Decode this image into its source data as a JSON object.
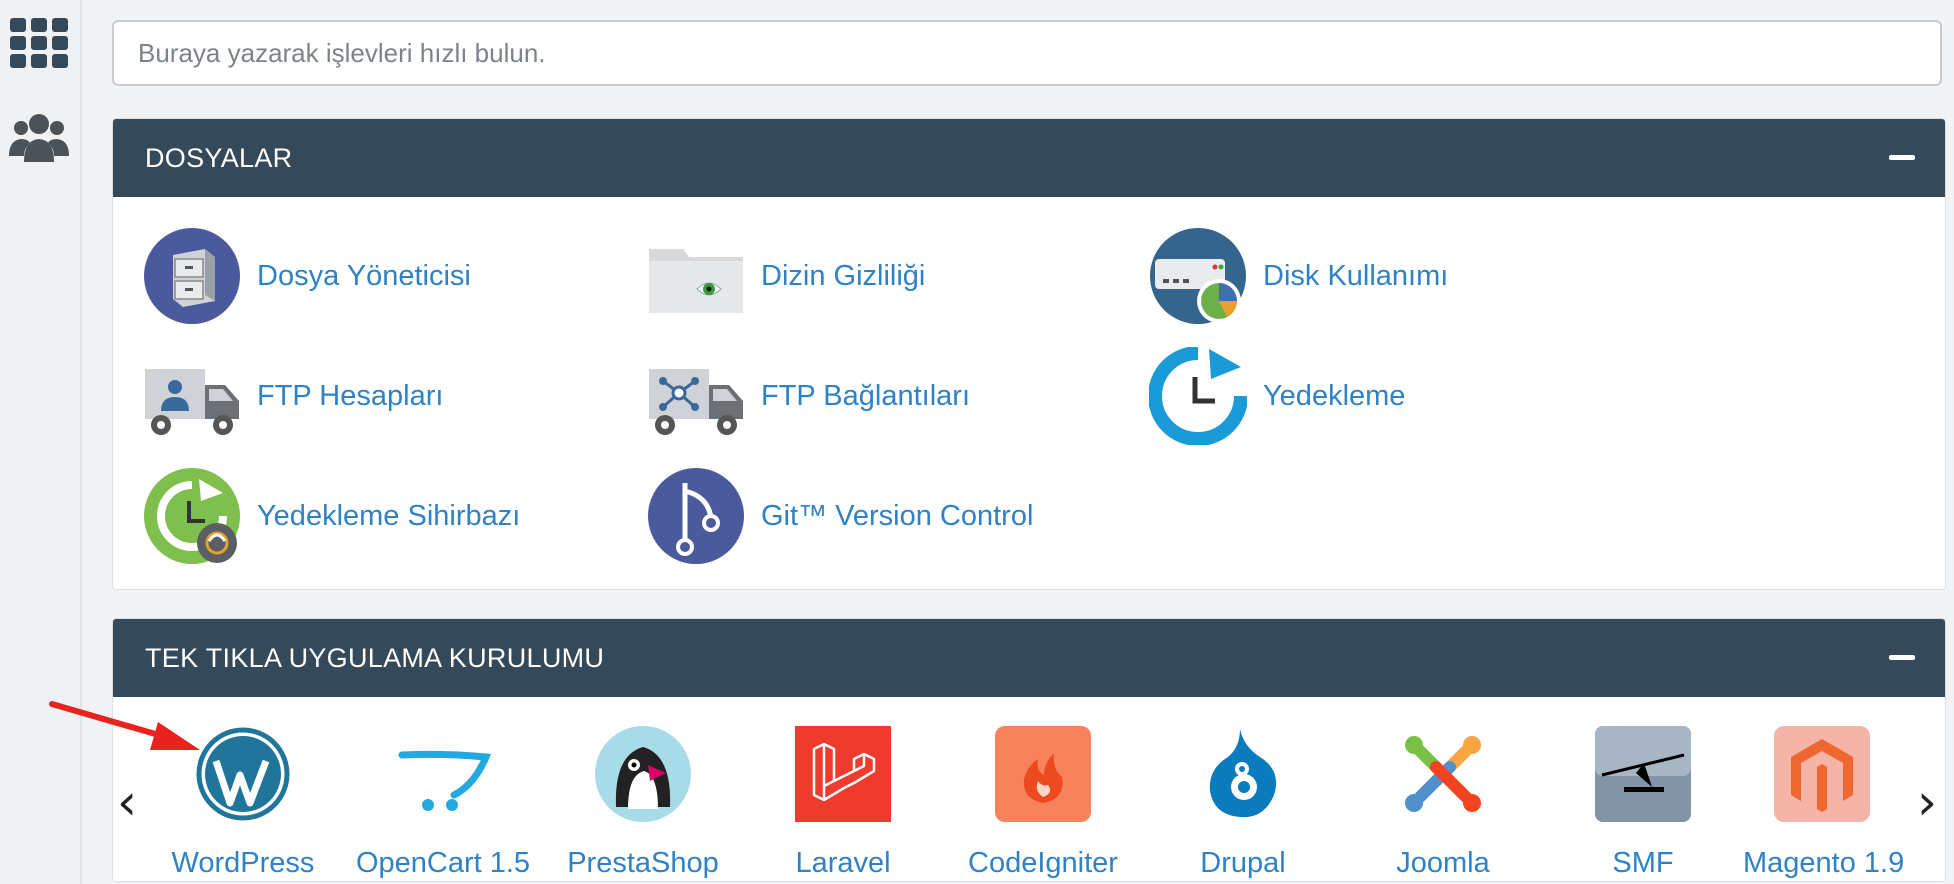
{
  "search": {
    "placeholder": "Buraya yazarak işlevleri hızlı bulun."
  },
  "rail": {
    "icons": [
      "grid-icon",
      "users-icon"
    ]
  },
  "files_panel": {
    "title": "DOSYALAR",
    "items": [
      {
        "label": "Dosya Yöneticisi",
        "icon": "file-cabinet-icon"
      },
      {
        "label": "Dizin Gizliliği",
        "icon": "folder-eye-icon"
      },
      {
        "label": "Disk Kullanımı",
        "icon": "disk-usage-icon"
      },
      {
        "label": "FTP Hesapları",
        "icon": "ftp-truck-user-icon"
      },
      {
        "label": "FTP Bağlantıları",
        "icon": "ftp-truck-network-icon"
      },
      {
        "label": "Yedekleme",
        "icon": "backup-clock-icon"
      },
      {
        "label": "Yedekleme Sihirbazı",
        "icon": "backup-wizard-icon"
      },
      {
        "label": "Git™ Version Control",
        "icon": "git-icon"
      }
    ]
  },
  "apps_panel": {
    "title": "TEK TIKLA UYGULAMA KURULUMU",
    "prev": "‹",
    "next": "›",
    "apps": [
      {
        "label": "WordPress",
        "icon": "wordpress-icon"
      },
      {
        "label": "OpenCart 1.5",
        "icon": "opencart-icon"
      },
      {
        "label": "PrestaShop",
        "icon": "prestashop-icon"
      },
      {
        "label": "Laravel",
        "icon": "laravel-icon"
      },
      {
        "label": "CodeIgniter",
        "icon": "codeigniter-icon"
      },
      {
        "label": "Drupal",
        "icon": "drupal-icon"
      },
      {
        "label": "Joomla",
        "icon": "joomla-icon"
      },
      {
        "label": "SMF",
        "icon": "smf-icon"
      },
      {
        "label": "Magento 1.9",
        "icon": "magento-icon"
      }
    ]
  },
  "colors": {
    "panel_header": "#34495a",
    "link": "#2f82c6",
    "annotation_arrow": "#e8231e"
  }
}
